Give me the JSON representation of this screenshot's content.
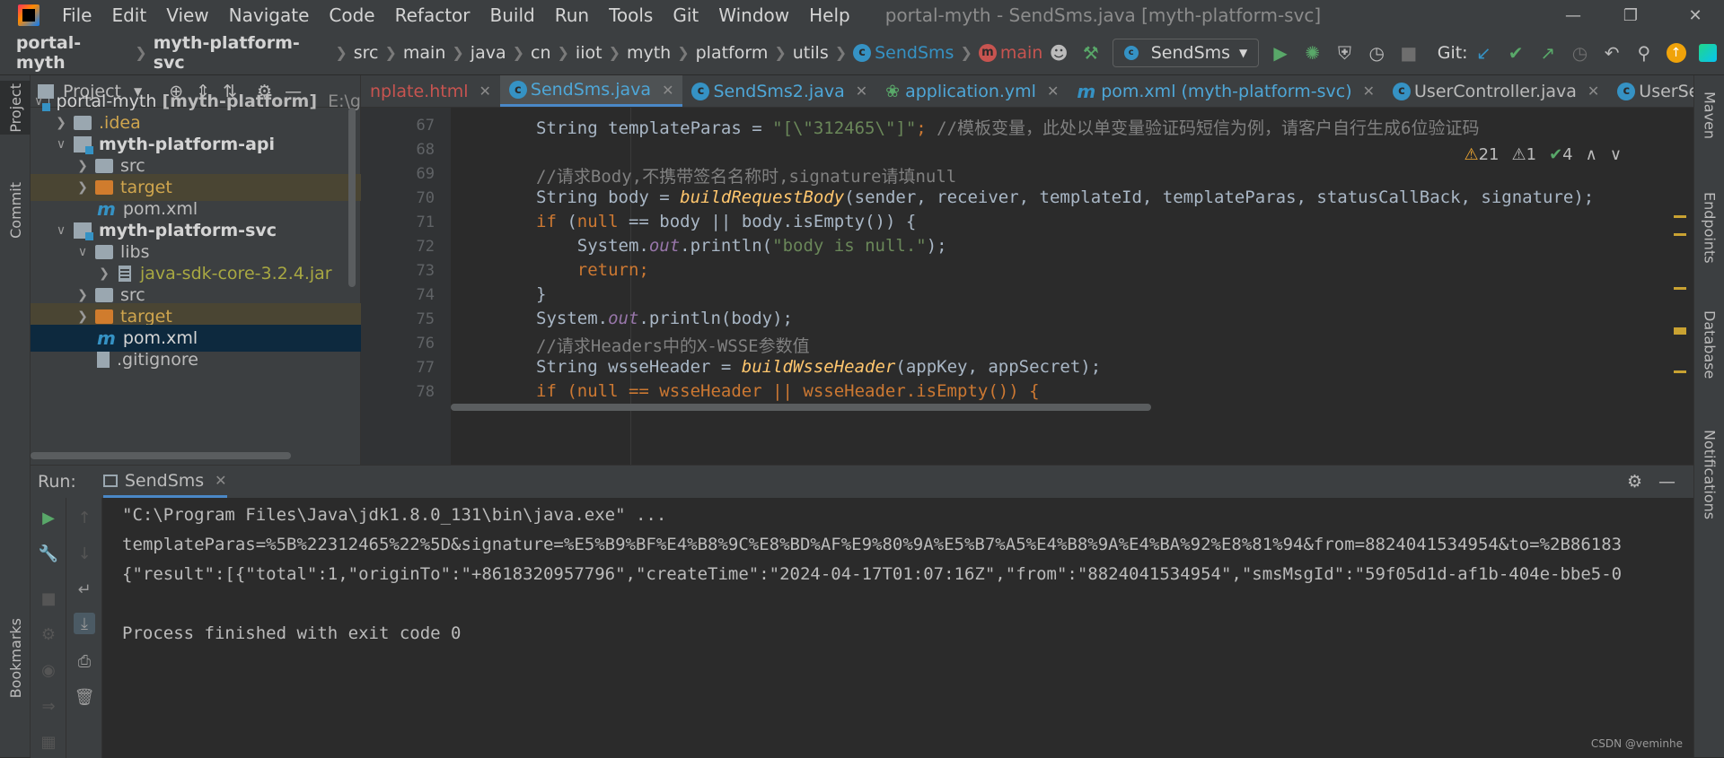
{
  "app": {
    "menu": [
      "File",
      "Edit",
      "View",
      "Navigate",
      "Code",
      "Refactor",
      "Build",
      "Run",
      "Tools",
      "Git",
      "Window",
      "Help"
    ],
    "window_title": "portal-myth - SendSms.java [myth-platform-svc]"
  },
  "breadcrumb": [
    "portal-myth",
    "myth-platform-svc",
    "src",
    "main",
    "java",
    "cn",
    "iiot",
    "myth",
    "platform",
    "utils",
    "SendSms",
    "main"
  ],
  "toolbar": {
    "run_config": "SendSms",
    "git_label": "Git:"
  },
  "project_panel": {
    "title": "Project",
    "tree": [
      {
        "label": "portal-myth",
        "suffix": "[myth-platform]",
        "hint": "E:\\g"
      },
      {
        "label": ".idea"
      },
      {
        "label": "myth-platform-api"
      },
      {
        "label": "src"
      },
      {
        "label": "target"
      },
      {
        "label": "pom.xml"
      },
      {
        "label": "myth-platform-svc"
      },
      {
        "label": "libs"
      },
      {
        "label": "java-sdk-core-3.2.4.jar"
      },
      {
        "label": "src"
      },
      {
        "label": "target"
      },
      {
        "label": "pom.xml"
      },
      {
        "label": ".gitignore"
      }
    ]
  },
  "tabs": [
    "nplate.html",
    "SendSms.java",
    "SendSms2.java",
    "application.yml",
    "pom.xml (myth-platform-svc)",
    "UserController.java",
    "UserSe"
  ],
  "inspections": {
    "warnings": "21",
    "weak": "1",
    "ok": "4"
  },
  "code": {
    "line_numbers": [
      "67",
      "68",
      "69",
      "70",
      "71",
      "72",
      "73",
      "74",
      "75",
      "76",
      "77",
      "78"
    ],
    "l67_a": "String templateParas = ",
    "l67_b": "\"[\\\"312465\\\"]\"",
    "l67_c": "; ",
    "l67_d": "//模板变量，此处以单变量验证码短信为例，请客户自行生成6位验证码",
    "l69": "//请求Body,不携带签名名称时,signature请填null",
    "l70_a": "String body = ",
    "l70_b": "buildRequestBody",
    "l70_c": "(sender, receiver, templateId, templateParas, statusCallBack, signature);",
    "l71_a": "if",
    "l71_b": " (",
    "l71_c": "null",
    "l71_d": " == body || body.isEmpty()) {",
    "l72_a": "    System.",
    "l72_b": "out",
    "l72_c": ".println(",
    "l72_d": "\"body is null.\"",
    "l72_e": ");",
    "l73": "    return;",
    "l74": "}",
    "l75_a": "System.",
    "l75_b": "out",
    "l75_c": ".println(body);",
    "l76": "//请求Headers中的X-WSSE参数值",
    "l77_a": "String wsseHeader = ",
    "l77_b": "buildWsseHeader",
    "l77_c": "(appKey, appSecret);",
    "l78": "if (null == wsseHeader || wsseHeader.isEmpty()) {"
  },
  "run_panel": {
    "label": "Run:",
    "tab": "SendSms",
    "output": [
      "\"C:\\Program Files\\Java\\jdk1.8.0_131\\bin\\java.exe\" ...",
      "templateParas=%5B%22312465%22%5D&signature=%E5%B9%BF%E4%B8%9C%E8%BD%AF%E9%80%9A%E5%B7%A5%E4%B8%9A%E4%BA%92%E8%81%94&from=8824041534954&to=%2B86183",
      "{\"result\":[{\"total\":1,\"originTo\":\"+8618320957796\",\"createTime\":\"2024-04-17T01:07:16Z\",\"from\":\"8824041534954\",\"smsMsgId\":\"59f05d1d-af1b-404e-bbe5-0",
      "",
      "Process finished with exit code 0"
    ]
  },
  "side_tabs": {
    "left": [
      "Project",
      "Commit",
      "Bookmarks"
    ],
    "right": [
      "Maven",
      "Endpoints",
      "Database",
      "Notifications"
    ]
  },
  "watermark": "CSDN @veminhe"
}
